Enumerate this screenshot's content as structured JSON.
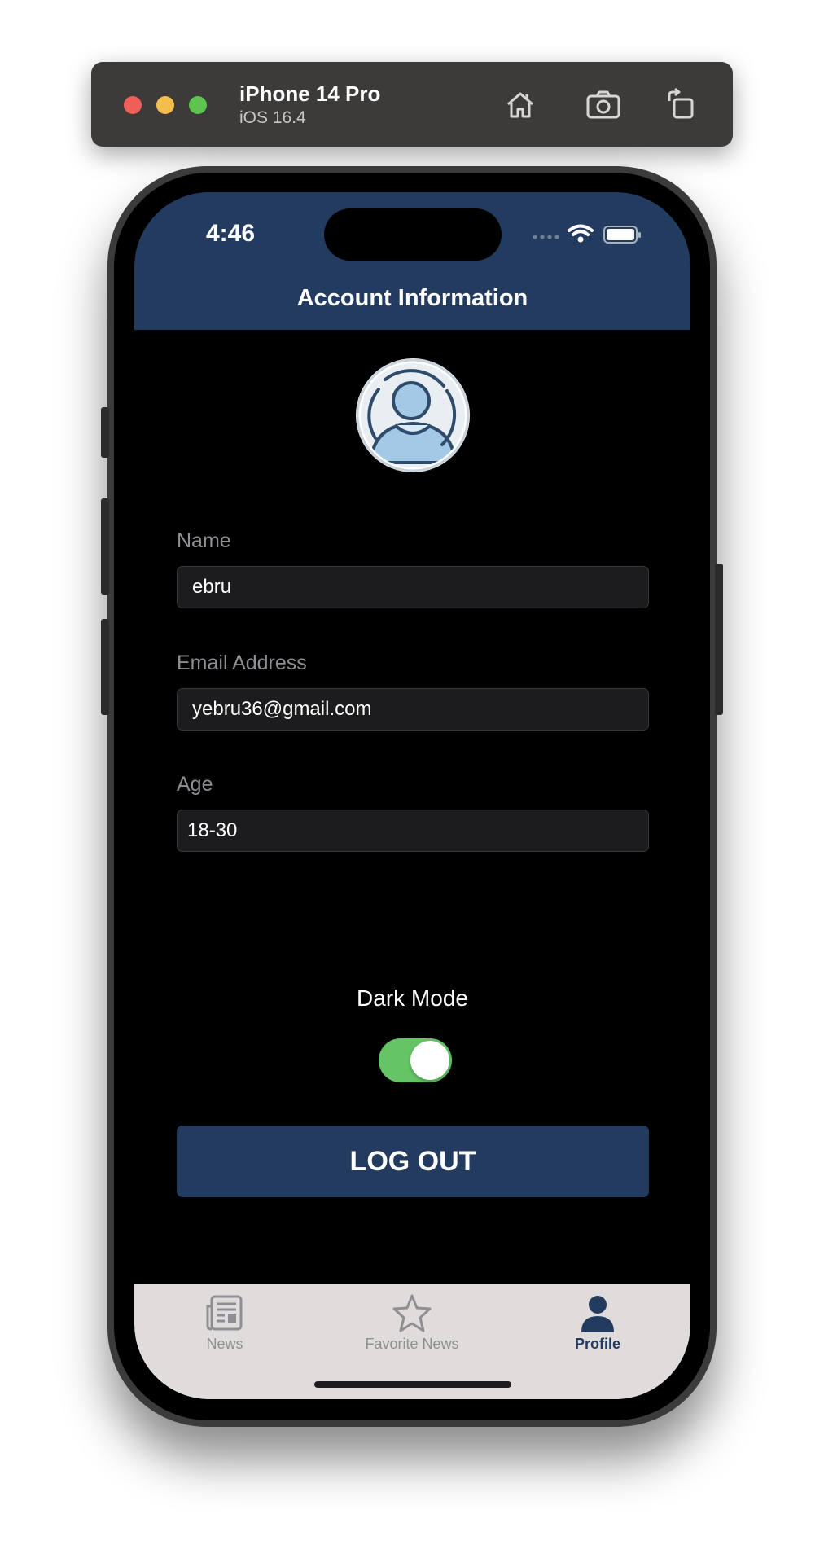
{
  "simulator": {
    "device_name": "iPhone 14 Pro",
    "os_version": "iOS 16.4",
    "buttons": [
      "home-icon",
      "screenshot-icon",
      "rotate-icon"
    ]
  },
  "status_bar": {
    "time": "4:46"
  },
  "nav": {
    "title": "Account Information"
  },
  "form": {
    "name_label": "Name",
    "name_value": "ebru",
    "email_label": "Email Address",
    "email_value": "yebru36@gmail.com",
    "age_label": "Age",
    "age_value": "18-30"
  },
  "settings": {
    "dark_mode_label": "Dark Mode",
    "dark_mode_on": true
  },
  "logout_label": "LOG OUT",
  "tabs": [
    {
      "label": "News",
      "icon": "newspaper-icon",
      "active": false
    },
    {
      "label": "Favorite News",
      "icon": "star-icon",
      "active": false
    },
    {
      "label": "Profile",
      "icon": "person-icon",
      "active": true
    }
  ],
  "colors": {
    "nav_background": "#223b5f",
    "toggle_on": "#65c466",
    "tabbar_background": "#dfdcdb"
  }
}
